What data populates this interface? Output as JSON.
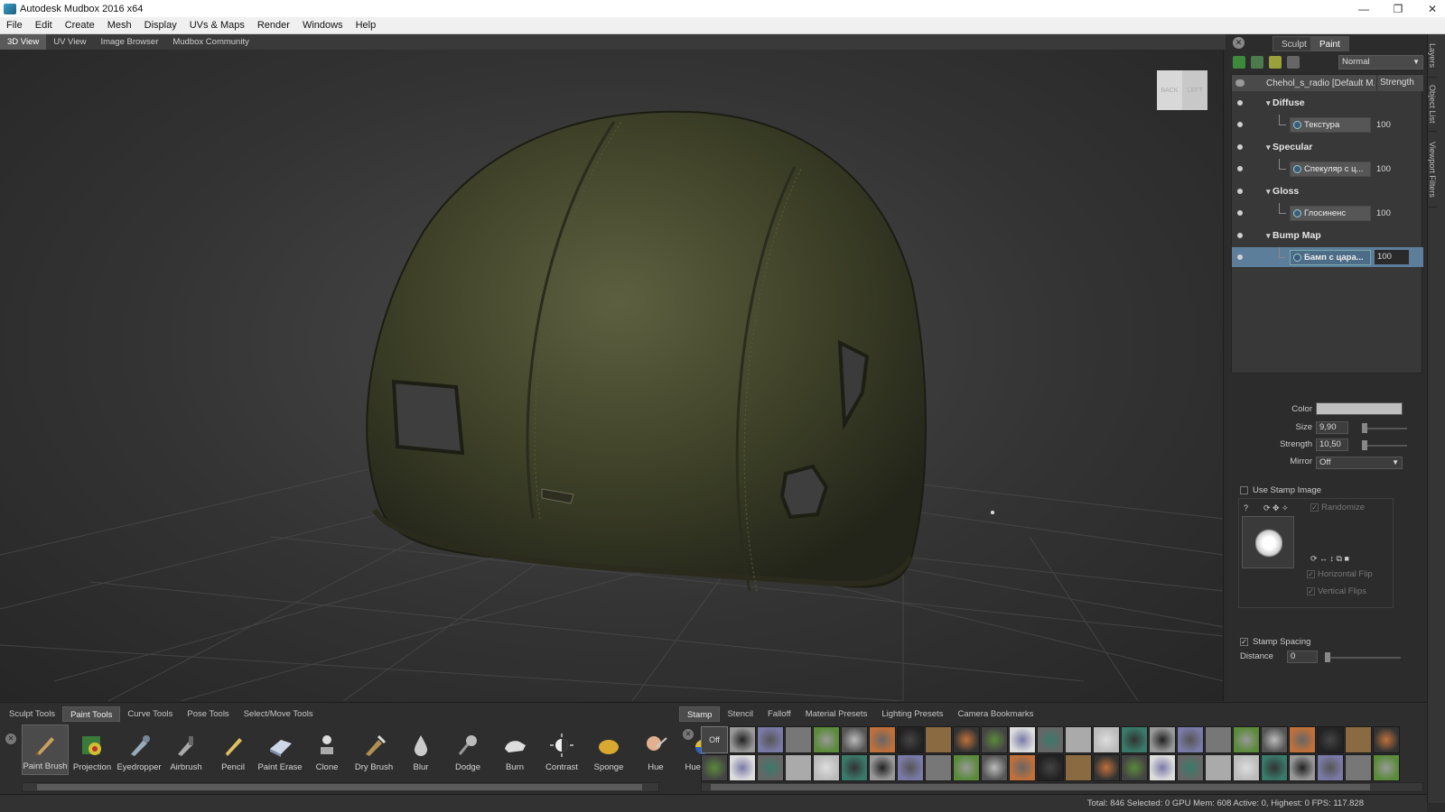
{
  "window": {
    "title": "Autodesk Mudbox 2016 x64",
    "controls": [
      "—",
      "❐",
      "✕"
    ]
  },
  "menu": [
    "File",
    "Edit",
    "Create",
    "Mesh",
    "Display",
    "UVs & Maps",
    "Render",
    "Windows",
    "Help"
  ],
  "view_tabs": [
    {
      "label": "3D View",
      "active": true
    },
    {
      "label": "UV View",
      "active": false
    },
    {
      "label": "Image Browser",
      "active": false
    },
    {
      "label": "Mudbox Community",
      "active": false
    }
  ],
  "viewcube": {
    "left_face": "BACK",
    "right_face": "LEFT"
  },
  "right_panel": {
    "mode_tabs": [
      {
        "label": "Sculpt",
        "active": false
      },
      {
        "label": "Paint",
        "active": true
      }
    ],
    "blend_mode": "Normal",
    "layers_header": {
      "name": "Chehol_s_radio [Default M...",
      "strength": "Strength"
    },
    "channels": [
      {
        "group": "Diffuse",
        "layer": "Текстура",
        "value": "100",
        "selected": false
      },
      {
        "group": "Specular",
        "layer": "Спекуляр с ц...",
        "value": "100",
        "selected": false
      },
      {
        "group": "Gloss",
        "layer": "Глосиненс",
        "value": "100",
        "selected": false
      },
      {
        "group": "Bump Map",
        "layer": "Бамп с цара...",
        "value": "100",
        "selected": true
      }
    ],
    "properties": {
      "color_label": "Color",
      "color_value": "#bfbfbf",
      "size_label": "Size",
      "size_value": "9,90",
      "strength_label": "Strength",
      "strength_value": "10,50",
      "mirror_label": "Mirror",
      "mirror_value": "Off",
      "use_stamp_image": "Use Stamp Image",
      "randomize": "Randomize",
      "horizontal_flip": "Horizontal Flip",
      "vertical_flips": "Vertical Flips",
      "stamp_spacing": "Stamp Spacing",
      "distance_label": "Distance",
      "distance_value": "0"
    },
    "side_tabs": [
      "Layers",
      "Object List",
      "Viewport Filters"
    ]
  },
  "tool_tray": {
    "tabs": [
      {
        "label": "Sculpt Tools",
        "active": false
      },
      {
        "label": "Paint Tools",
        "active": true
      },
      {
        "label": "Curve Tools",
        "active": false
      },
      {
        "label": "Pose Tools",
        "active": false
      },
      {
        "label": "Select/Move Tools",
        "active": false
      }
    ],
    "tools": [
      {
        "label": "Paint Brush",
        "icon": "paint-brush-icon",
        "active": true
      },
      {
        "label": "Projection",
        "icon": "projection-icon",
        "active": false
      },
      {
        "label": "Eyedropper",
        "icon": "eyedropper-icon",
        "active": false
      },
      {
        "label": "Airbrush",
        "icon": "airbrush-icon",
        "active": false
      },
      {
        "label": "Pencil",
        "icon": "pencil-icon",
        "active": false
      },
      {
        "label": "Paint Erase",
        "icon": "eraser-icon",
        "active": false
      },
      {
        "label": "Clone",
        "icon": "clone-stamp-icon",
        "active": false
      },
      {
        "label": "Dry Brush",
        "icon": "dry-brush-icon",
        "active": false
      },
      {
        "label": "Blur",
        "icon": "blur-drop-icon",
        "active": false
      },
      {
        "label": "Dodge",
        "icon": "dodge-icon",
        "active": false
      },
      {
        "label": "Burn",
        "icon": "burn-hand-icon",
        "active": false
      },
      {
        "label": "Contrast",
        "icon": "contrast-icon",
        "active": false
      },
      {
        "label": "Sponge",
        "icon": "sponge-icon",
        "active": false
      },
      {
        "label": "Hue",
        "icon": "hue-face-icon",
        "active": false
      },
      {
        "label": "Hue Shift",
        "icon": "hue-shift-icon",
        "active": false
      }
    ]
  },
  "stamp_tray": {
    "tabs": [
      {
        "label": "Stamp",
        "active": true
      },
      {
        "label": "Stencil",
        "active": false
      },
      {
        "label": "Falloff",
        "active": false
      },
      {
        "label": "Material Presets",
        "active": false
      },
      {
        "label": "Lighting Presets",
        "active": false
      },
      {
        "label": "Camera Bookmarks",
        "active": false
      }
    ],
    "off_label": "Off"
  },
  "status": "Total: 846  Selected: 0  GPU Mem: 608  Active: 0, Highest: 0  FPS: 117.828"
}
